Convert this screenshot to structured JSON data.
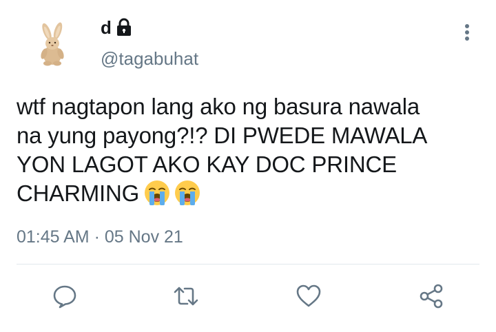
{
  "author": {
    "display_name": "d",
    "handle": "@tagabuhat",
    "protected": true,
    "avatar_icon": "bunny-plush-avatar"
  },
  "tweet": {
    "lines": [
      "wtf nagtapon lang ako ng basura nawala",
      "na yung payong?!? DI PWEDE MAWALA",
      "YON LAGOT AKO KAY DOC PRINCE",
      "CHARMING"
    ],
    "emojis": [
      "loudly-crying-face",
      "loudly-crying-face"
    ]
  },
  "meta": {
    "time": "01:45 AM",
    "separator": "·",
    "date": "05 Nov 21"
  },
  "actions": [
    "reply-icon",
    "retweet-icon",
    "like-icon",
    "share-icon"
  ],
  "colors": {
    "text": "#14171a",
    "secondary": "#657786",
    "divider": "#e1e8ed",
    "icon": "#657786"
  }
}
